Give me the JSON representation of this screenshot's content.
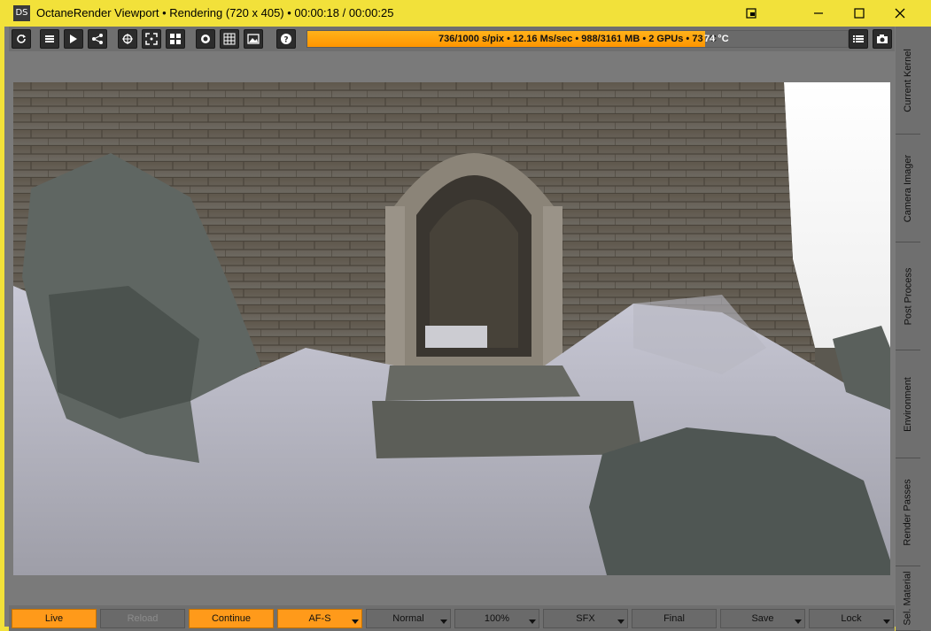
{
  "titlebar": {
    "logo_text": "DS",
    "title": "OctaneRender Viewport • Rendering (720 x 405) • 00:00:18 / 00:00:25"
  },
  "toolbar": {
    "left_icons": [
      "refresh-icon",
      "list-icon",
      "forward-icon",
      "share-icon",
      "crosshair-icon",
      "focus-icon",
      "grid4-icon",
      "circle-icon",
      "grid-icon",
      "image-icon",
      "help-icon"
    ],
    "right_icons": [
      "menu-icon",
      "camera-icon"
    ]
  },
  "progress": {
    "fraction": 0.736,
    "text": "736/1000 s/pix • 12.16 Ms/sec • 988/3161 MB • 2 GPUs • 73 °C",
    "temp_overflow": "74 °C"
  },
  "side_tabs": [
    "Current Kernel",
    "Camera Imager",
    "Post Process",
    "Environment",
    "Render Passes",
    "Sel. Material"
  ],
  "bottom_buttons": [
    {
      "label": "Live",
      "style": "orange",
      "arrow": false
    },
    {
      "label": "Reload",
      "style": "disabled",
      "arrow": false
    },
    {
      "label": "Continue",
      "style": "orange",
      "arrow": false
    },
    {
      "label": "AF-S",
      "style": "orange",
      "arrow": true
    },
    {
      "label": "Normal",
      "style": "normal",
      "arrow": true
    },
    {
      "label": "100%",
      "style": "normal",
      "arrow": true
    },
    {
      "label": "SFX",
      "style": "normal",
      "arrow": true
    },
    {
      "label": "Final",
      "style": "normal",
      "arrow": false
    },
    {
      "label": "Save",
      "style": "normal",
      "arrow": true
    },
    {
      "label": "Lock",
      "style": "normal",
      "arrow": true
    }
  ],
  "colors": {
    "accent": "#f2e13a",
    "progress": "#ff9a1a"
  }
}
